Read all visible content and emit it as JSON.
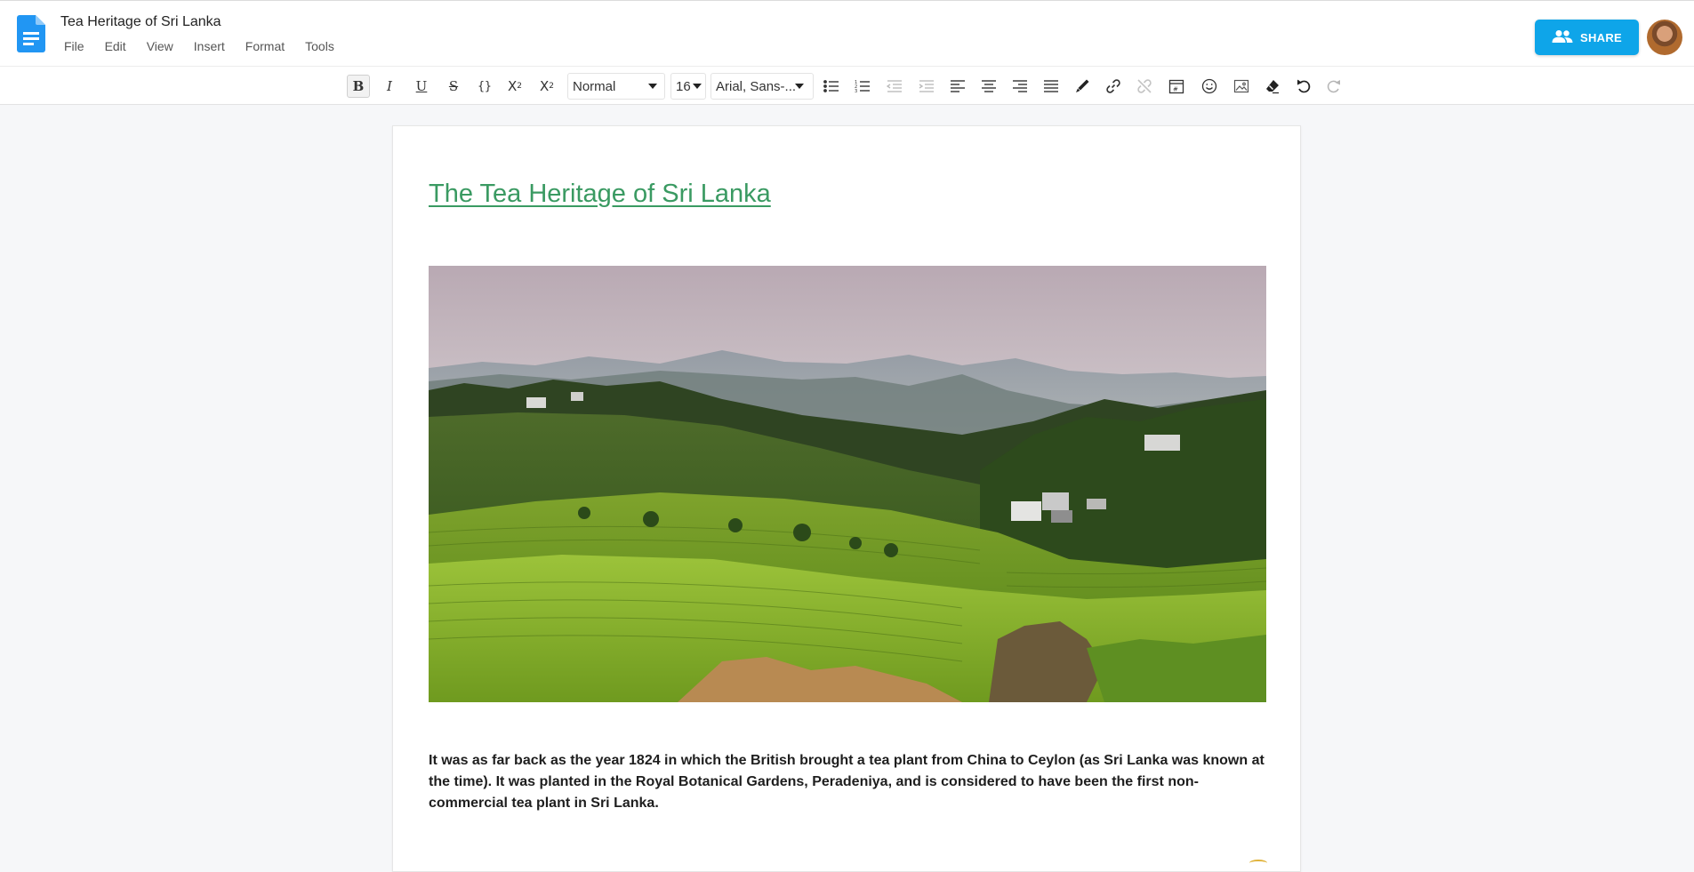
{
  "app": {
    "doc_title": "Tea Heritage of Sri Lanka",
    "accent_color": "#0ea5e9",
    "heading_color": "#3a9a62"
  },
  "menu": {
    "items": [
      "File",
      "Edit",
      "View",
      "Insert",
      "Format",
      "Tools"
    ]
  },
  "header": {
    "share_label": "SHARE",
    "share_icon": "people-icon",
    "avatar": "user-avatar"
  },
  "toolbar": {
    "bold": "B",
    "italic": "I",
    "underline": "U",
    "strikethrough": "S",
    "code": "{}",
    "superscript_base": "X",
    "superscript_exp": "2",
    "subscript_base": "X",
    "subscript_exp": "2",
    "paragraph_style": "Normal",
    "font_size": "16",
    "font_family": "Arial, Sans-...",
    "icons": [
      "bulleted-list-icon",
      "numbered-list-icon",
      "decrease-indent-icon",
      "increase-indent-icon",
      "align-left-icon",
      "align-center-icon",
      "align-right-icon",
      "justify-icon",
      "text-color-icon",
      "link-icon",
      "unlink-icon",
      "calendar-icon",
      "emoji-icon",
      "image-icon",
      "clear-format-icon",
      "undo-icon",
      "redo-icon"
    ]
  },
  "document": {
    "heading": "The Tea Heritage of Sri Lanka",
    "image": "tea-plantation-landscape",
    "paragraph": "It was as far back as the year 1824 in which the British brought a tea plant from China to Ceylon (as Sri Lanka was known at the time). It was planted in the Royal Botanical Gardens, Peradeniya, and is considered to have been the first non-commercial tea plant in Sri Lanka."
  }
}
